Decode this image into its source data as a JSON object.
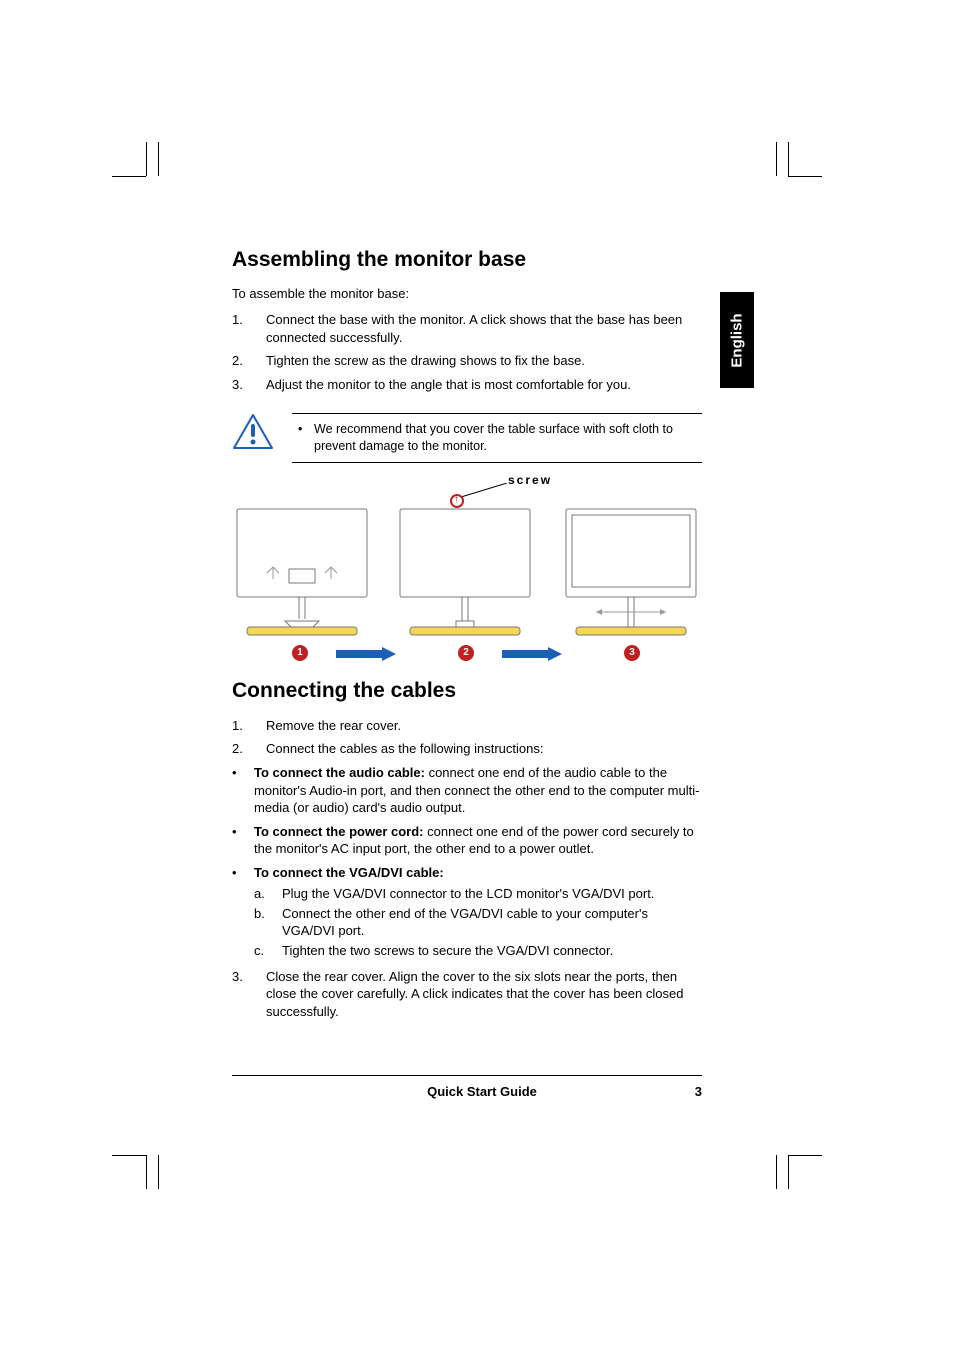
{
  "lang_tab": "English",
  "section1": {
    "heading": "Assembling the monitor base",
    "intro": "To assemble the monitor base:",
    "steps": [
      {
        "n": "1.",
        "t": "Connect the base with the monitor. A click shows that the base has been connected successfully."
      },
      {
        "n": "2.",
        "t": "Tighten the screw as the drawing shows to fix the base."
      },
      {
        "n": "3.",
        "t": "Adjust the monitor to the angle that is most comfortable for you."
      }
    ],
    "note": "We recommend that you cover the table surface with soft cloth to prevent damage to the monitor.",
    "diagram_label": "screw",
    "badges": [
      "1",
      "2",
      "3"
    ]
  },
  "section2": {
    "heading": "Connecting the cables",
    "steps_top": [
      {
        "n": "1.",
        "t": "Remove the rear cover."
      },
      {
        "n": "2.",
        "t": "Connect the cables as the following instructions:"
      }
    ],
    "bullets": [
      {
        "bold": "To connect the audio cable:",
        "rest": " connect one end of the audio cable to the monitor's Audio-in port, and then connect the other end to the computer multi-media (or audio) card's audio output."
      },
      {
        "bold": "To connect the power cord:",
        "rest": " connect one end of the power cord securely to the monitor's AC input port, the other end to a power outlet."
      },
      {
        "bold": "To connect the VGA/DVI cable:",
        "rest": ""
      }
    ],
    "sub": [
      {
        "l": "a.",
        "t": "Plug the VGA/DVI connector to the LCD monitor's VGA/DVI port."
      },
      {
        "l": "b.",
        "t": "Connect the other end of the VGA/DVI cable to your computer's VGA/DVI port."
      },
      {
        "l": "c.",
        "t": "Tighten the two screws to secure the VGA/DVI connector."
      }
    ],
    "step3": {
      "n": "3.",
      "t": "Close the rear cover. Align the cover to the six slots near the ports, then close the cover carefully. A click indicates that the cover has been closed successfully."
    }
  },
  "footer": {
    "title": "Quick Start Guide",
    "page": "3"
  }
}
